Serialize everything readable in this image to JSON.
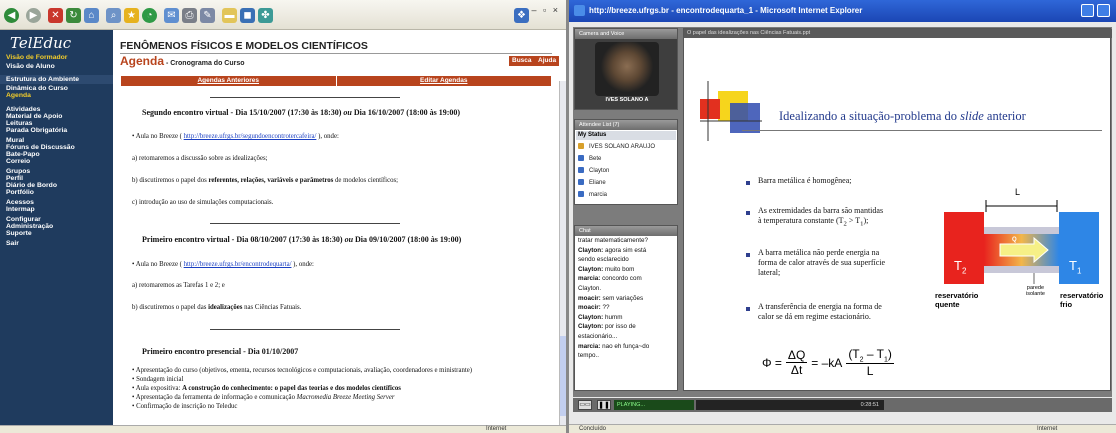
{
  "left": {
    "logo": "TelEduc",
    "sidebar": [
      {
        "label": "Visão de Formador",
        "style": "y"
      },
      {
        "label": "Visão de Aluno",
        "style": "w"
      },
      {
        "label": "Estrutura do Ambiente",
        "style": "sec"
      },
      {
        "label": "Dinâmica do Curso",
        "style": "w"
      },
      {
        "label": "Agenda",
        "style": "y"
      },
      {
        "label": "Atividades",
        "style": "w"
      },
      {
        "label": "Material de Apoio",
        "style": "w"
      },
      {
        "label": "Leituras",
        "style": "w"
      },
      {
        "label": "Parada Obrigatória",
        "style": "w"
      },
      {
        "label": "Mural",
        "style": "w"
      },
      {
        "label": "Fóruns de Discussão",
        "style": "w"
      },
      {
        "label": "Bate-Papo",
        "style": "w"
      },
      {
        "label": "Correio",
        "style": "w"
      },
      {
        "label": "Grupos",
        "style": "w"
      },
      {
        "label": "Perfil",
        "style": "w"
      },
      {
        "label": "Diário de Bordo",
        "style": "w"
      },
      {
        "label": "Portfólio",
        "style": "w"
      },
      {
        "label": "Acessos",
        "style": "w"
      },
      {
        "label": "Intermap",
        "style": "w"
      },
      {
        "label": "Configurar",
        "style": "w"
      },
      {
        "label": "Administração",
        "style": "w"
      },
      {
        "label": "Suporte",
        "style": "w"
      },
      {
        "label": "Sair",
        "style": "w"
      }
    ],
    "page_title": "FENÔMENOS FÍSICOS E MODELOS CIENTÍFICOS",
    "agenda_title": "Agenda",
    "agenda_sub": " - Cronograma do Curso",
    "buscar": "Busca",
    "ajuda": "Ajuda",
    "nav_left": "Agendas Anteriores",
    "nav_right": "Editar Agendas",
    "section1": {
      "heading_pre": "Segundo encontro virtual - Dia 15/10/2007 (17:30 às 18:30) ",
      "heading_ou": "ou",
      "heading_post": " Dia 16/10/2007 (18:00 às 19:00)",
      "item_pre": "• Aula no Breeze ( ",
      "link": "http://breeze.ufrgs.br/segundoencontrotercafeira/",
      "item_post": " ), onde:",
      "a": "a) retomaremos a discussão sobre as idealizações;",
      "b_pre": "b) discutiremos o papel dos ",
      "b_bold": "referentes, relações, variáveis e parâmetros",
      "b_post": " de modelos científicos;",
      "c": "c) introdução ao uso de simulações computacionais."
    },
    "section2": {
      "heading_pre": "Primeiro encontro virtual - Dia 08/10/2007 (17:30 às 18:30) ",
      "heading_ou": "ou",
      "heading_post": " Dia 09/10/2007 (18:00 às 19:00)",
      "item_pre": "• Aula no Breeze ( ",
      "link": "http://breeze.ufrgs.br/encontrodequarta/",
      "item_post": " ), onde:",
      "a": "a) retomaremos as Tarefas 1 e 2; e",
      "b_pre": "b) discutiremos o papel das ",
      "b_bold": "idealizações",
      "b_post": " nas Ciências Fatuais."
    },
    "section3": {
      "heading": "Primeiro encontro presencial - Dia 01/10/2007",
      "l1": "• Apresentação do curso (objetivos, ementa, recursos tecnológicos e computacionais, avaliação, coordenadores e ministrante)",
      "l2": "• Sondagem inicial",
      "l3_pre": "• Aula expositiva: ",
      "l3_bold": "A construção do conhecimento: o papel das teorias e dos modelos científicos",
      "l4_pre": "• Apresentação da ferramenta de informação e comunicação ",
      "l4_it": "Macromedia Breeze Meeting Server",
      "l5": "• Confirmação de inscrição no Teleduc"
    },
    "status": "Internet"
  },
  "right": {
    "window_title": "http://breeze.ufrgs.br - encontrodequarta_1 - Microsoft Internet Explorer",
    "camera_header": "Camera and Voice",
    "camera_name": "IVES SOLANO A",
    "attendee_header": "Attendee List (7)",
    "my_status": "My Status",
    "attendees": [
      "IVES SOLANO ARAUJO",
      "Bete",
      "Clayton",
      "Eliane",
      "marcia"
    ],
    "chat_header": "Chat",
    "chat": [
      {
        "who": "",
        "text": "tratar matematicamente?"
      },
      {
        "who": "Clayton:",
        "text": " agora sim está"
      },
      {
        "who": "",
        "text": "sendo esclarecido"
      },
      {
        "who": "Clayton:",
        "text": " muito bom"
      },
      {
        "who": "marcia:",
        "text": " concordo com"
      },
      {
        "who": "",
        "text": "Clayton."
      },
      {
        "who": "moacir:",
        "text": " sem variações"
      },
      {
        "who": "moacir:",
        "text": " ??"
      },
      {
        "who": "Clayton:",
        "text": " humm"
      },
      {
        "who": "Clayton:",
        "text": " por isso de"
      },
      {
        "who": "",
        "text": "estacionário..."
      },
      {
        "who": "marcia:",
        "text": " nao eh funça~do"
      },
      {
        "who": "",
        "text": "tempo.."
      }
    ],
    "slide_header": "O papel das idealizações nas Ciências Fatuais.ppt",
    "slide_title_pre": "Idealizando a situação-problema do ",
    "slide_title_it": "slide",
    "slide_title_post": " anterior",
    "bullets": [
      [
        "Barra metálica é homogênea;"
      ],
      [
        "As extremidades da barra são mantidas",
        "à temperatura constante (T",
        "2",
        " > T",
        "1",
        ");"
      ],
      [
        "A barra metálica não perde energia na",
        "forma de calor através de sua superfície",
        "lateral;"
      ],
      [
        "A transferência de energia na forma de",
        "calor se dá em regime estacionário."
      ]
    ],
    "diagram": {
      "L": "L",
      "T2": "T",
      "T2sub": "2",
      "T1": "T",
      "T1sub": "1",
      "Q": "Q",
      "parede": "parede",
      "isolante": "isolante",
      "hot_label_1": "reservatório",
      "hot_label_2": "quente",
      "cold_label_1": "reservatório",
      "cold_label_2": "frio",
      "hot_color": "#e8231e",
      "cold_color": "#2e86e6"
    },
    "formula": {
      "phi": "Φ =",
      "num": "ΔQ",
      "den": "Δt",
      "mid": "= –kA",
      "fnum": "(T",
      "fnum_s2": "2",
      "fnum_m": " – T",
      "fnum_s1": "1",
      "fnum_e": ")",
      "fden": "L"
    },
    "playing": "PLAYING...",
    "time": "0:28:51",
    "status_left": "Concluído",
    "status_right": "Internet"
  }
}
